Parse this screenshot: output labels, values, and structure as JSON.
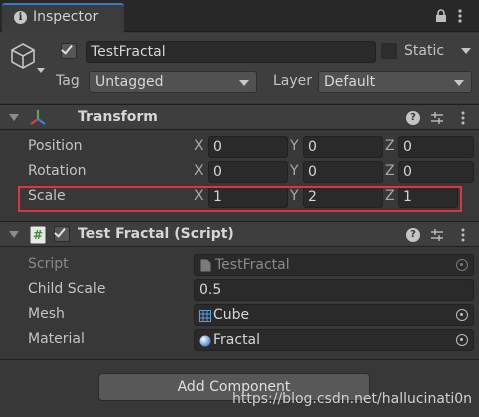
{
  "tab": {
    "label": "Inspector",
    "icon": "info-icon"
  },
  "header": {
    "name": "TestFractal",
    "active": true,
    "static_label": "Static",
    "static_checked": false,
    "tag_label": "Tag",
    "tag_value": "Untagged",
    "layer_label": "Layer",
    "layer_value": "Default"
  },
  "transform": {
    "title": "Transform",
    "rows": [
      {
        "label": "Position",
        "x": "0",
        "y": "0",
        "z": "0"
      },
      {
        "label": "Rotation",
        "x": "0",
        "y": "0",
        "z": "0"
      },
      {
        "label": "Scale",
        "x": "1",
        "y": "2",
        "z": "1"
      }
    ],
    "axis_labels": {
      "x": "X",
      "y": "Y",
      "z": "Z"
    }
  },
  "script_component": {
    "title": "Test Fractal (Script)",
    "enabled": true,
    "fields": [
      {
        "label": "Script",
        "value": "TestFractal",
        "icon": "script-file-icon"
      },
      {
        "label": "Child Scale",
        "value": "0.5"
      },
      {
        "label": "Mesh",
        "value": "Cube",
        "icon": "mesh-grid-icon"
      },
      {
        "label": "Material",
        "value": "Fractal",
        "icon": "material-sphere-icon"
      }
    ]
  },
  "add_component_label": "Add Component",
  "watermark": "https://blog.csdn.net/hallucinati0n",
  "colors": {
    "highlight": "#d9363e",
    "tab_accent": "#3a79bb",
    "background": "#383838"
  }
}
